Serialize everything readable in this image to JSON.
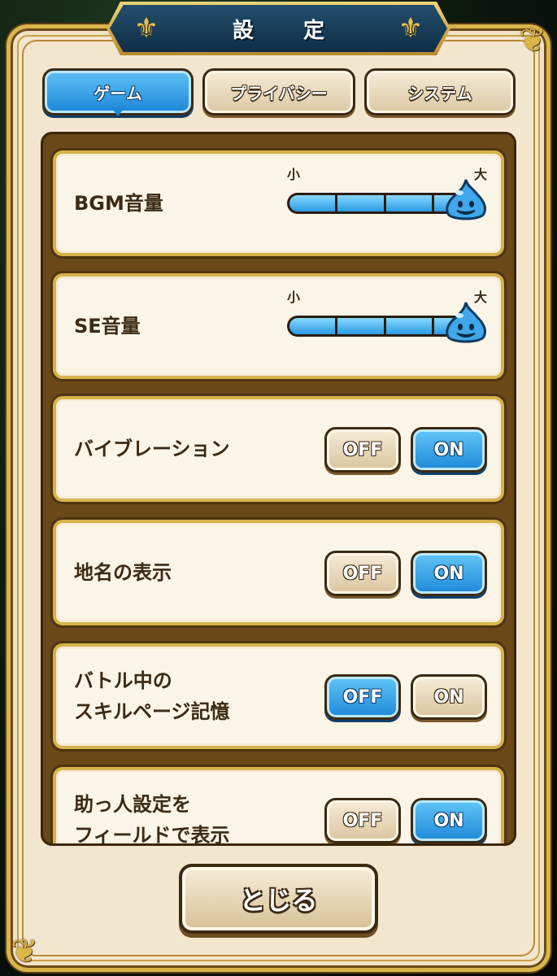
{
  "header": {
    "title": "設 定"
  },
  "tabs": [
    {
      "label": "ゲーム",
      "active": true
    },
    {
      "label": "プライバシー",
      "active": false
    },
    {
      "label": "システム",
      "active": false
    }
  ],
  "settings": {
    "bgm": {
      "label": "BGM音量",
      "min_label": "小",
      "max_label": "大",
      "level_percent": 100
    },
    "se": {
      "label": "SE音量",
      "min_label": "小",
      "max_label": "大",
      "level_percent": 100
    },
    "vibration": {
      "label": "バイブレーション",
      "off_label": "OFF",
      "on_label": "ON",
      "value": "ON"
    },
    "place_name": {
      "label": "地名の表示",
      "off_label": "OFF",
      "on_label": "ON",
      "value": "ON"
    },
    "skill_page_memory": {
      "label": "バトル中の\nスキルページ記憶",
      "off_label": "OFF",
      "on_label": "ON",
      "value": "OFF"
    },
    "helper_field": {
      "label": "助っ人設定を\nフィールドで表示",
      "off_label": "OFF",
      "on_label": "ON",
      "value": "ON"
    }
  },
  "footer": {
    "close_label": "とじる"
  },
  "colors": {
    "accent_blue": "#1e88d8",
    "parchment": "#f2e6cf",
    "gold": "#d9b54a",
    "text_brown": "#3b2a14"
  },
  "icons": {
    "slider_knob": "slime-icon",
    "title_ornament": "fleur-de-lis-icon"
  }
}
